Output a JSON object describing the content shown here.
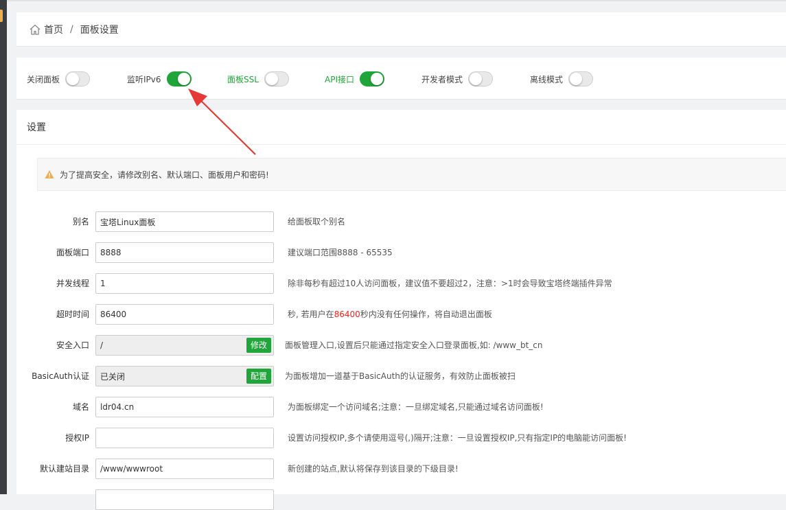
{
  "breadcrumb": {
    "home": "首页",
    "separator": "/",
    "current": "面板设置"
  },
  "switches": [
    {
      "label": "关闭面板",
      "on": false,
      "label_color": "#444444"
    },
    {
      "label": "监听IPv6",
      "on": true,
      "label_color": "#444444"
    },
    {
      "label": "面板SSL",
      "on": false,
      "label_color": "#20a53a"
    },
    {
      "label": "API接口",
      "on": true,
      "label_color": "#20a53a"
    },
    {
      "label": "开发者模式",
      "on": false,
      "label_color": "#444444"
    },
    {
      "label": "离线模式",
      "on": false,
      "label_color": "#444444"
    }
  ],
  "settings": {
    "title": "设置",
    "warning": "为了提高安全，请修改别名、默认端口、面板用户和密码!",
    "rows": {
      "alias": {
        "label": "别名",
        "value": "宝塔Linux面板",
        "help": "给面板取个别名"
      },
      "port": {
        "label": "面板端口",
        "value": "8888",
        "help": "建议端口范围8888 - 65535"
      },
      "threads": {
        "label": "并发线程",
        "value": "1",
        "help": "除非每秒有超过10人访问面板，建议值不要超过2，注意：>1时会导致宝塔终端插件异常"
      },
      "timeout": {
        "label": "超时时间",
        "value": "86400",
        "help_prefix": "秒, 若用户在",
        "help_highlight": "86400",
        "help_suffix": "秒内没有任何操作，将自动退出面板"
      },
      "entry": {
        "label": "安全入口",
        "value": "/",
        "button": "修改",
        "help": "面板管理入口,设置后只能通过指定安全入口登录面板,如: /www_bt_cn"
      },
      "basicauth": {
        "label": "BasicAuth认证",
        "value": "已关闭",
        "button": "配置",
        "help": "为面板增加一道基于BasicAuth的认证服务，有效防止面板被扫"
      },
      "domain": {
        "label": "域名",
        "value": "ldr04.cn",
        "help": "为面板绑定一个访问域名;注意：一旦绑定域名,只能通过域名访问面板!"
      },
      "authip": {
        "label": "授权IP",
        "value": "",
        "help": "设置访问授权IP,多个请使用逗号(,)隔开;注意：一旦设置授权IP,只有指定IP的电脑能访问面板!"
      },
      "siteroot": {
        "label": "默认建站目录",
        "value": "/www/wwwroot",
        "help": "新创建的站点,默认将保存到该目录的下级目录!"
      }
    }
  },
  "colors": {
    "accent_green": "#20a53a",
    "annotation_arrow": "#e53935",
    "warning_icon": "#f0ad4e"
  },
  "icons": {
    "home": "home-icon",
    "warning": "warning-icon",
    "annotation": "arrow-annotation"
  }
}
